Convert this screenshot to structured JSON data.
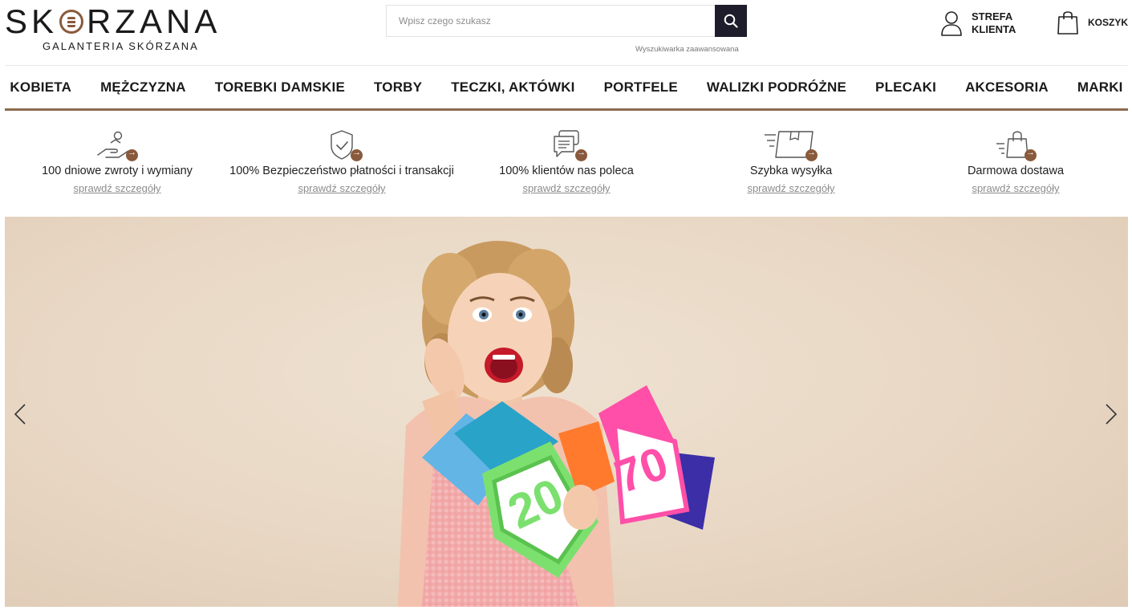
{
  "brand": {
    "name_left": "SK",
    "name_right": "RZANA",
    "subtitle": "GALANTERIA SKÓRZANA",
    "accent_color": "#8a5a3c"
  },
  "search": {
    "placeholder": "Wpisz czego szukasz",
    "button_icon": "search-icon",
    "advanced_link": "Wyszukiwarka zaawansowana"
  },
  "account": {
    "icon": "user-icon",
    "label_line1": "STREFA",
    "label_line2": "KLIENTA"
  },
  "cart": {
    "icon": "shopping-bag-icon",
    "label": "KOSZYK"
  },
  "nav": {
    "items": [
      {
        "label": "KOBIETA"
      },
      {
        "label": "MĘŻCZYZNA"
      },
      {
        "label": "TOREBKI DAMSKIE"
      },
      {
        "label": "TORBY"
      },
      {
        "label": "TECZKI, AKTÓWKI"
      },
      {
        "label": "PORTFELE"
      },
      {
        "label": "WALIZKI PODRÓŻNE"
      },
      {
        "label": "PLECAKI"
      },
      {
        "label": "AKCESORIA"
      },
      {
        "label": "MARKI"
      }
    ],
    "underline_color": "#8a6a4d"
  },
  "features": [
    {
      "icon": "return-hand-icon",
      "title": "100 dniowe zwroty i wymiany",
      "link": "sprawdź szczegóły"
    },
    {
      "icon": "shield-check-icon",
      "title": "100% Bezpieczeństwo płatności i transakcji",
      "link": "sprawdź szczegóły"
    },
    {
      "icon": "chat-icon",
      "title": "100% klientów nas poleca",
      "link": "sprawdź szczegóły"
    },
    {
      "icon": "fast-delivery-box-icon",
      "title": "Szybka wysyłka",
      "link": "sprawdź szczegóły"
    },
    {
      "icon": "shopping-bag-fast-icon",
      "title": "Darmowa dostawa",
      "link": "sprawdź szczegóły"
    }
  ],
  "hero": {
    "prev_icon": "chevron-left-icon",
    "next_icon": "chevron-right-icon",
    "image": "woman-holding-sale-percent-signs"
  }
}
